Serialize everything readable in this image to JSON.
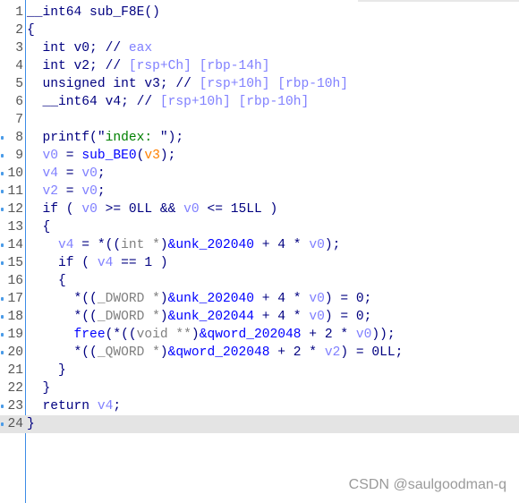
{
  "colors": {
    "default": "#000080",
    "variable": "#8080ff",
    "type": "#808080",
    "function": "#0000ff",
    "string": "#008000",
    "argument": "#ff8000",
    "gutter_border": "#3c8ce6",
    "current_line": "#e4e4e4"
  },
  "current_line": 24,
  "lines": [
    {
      "n": "1",
      "dot": false,
      "tokens": [
        [
          "__int64 sub_F8E()",
          "n"
        ]
      ]
    },
    {
      "n": "2",
      "dot": false,
      "tokens": [
        [
          "{",
          "n"
        ]
      ]
    },
    {
      "n": "3",
      "dot": false,
      "tokens": [
        [
          "  int v0; // ",
          "n"
        ],
        [
          "eax",
          "c"
        ]
      ]
    },
    {
      "n": "4",
      "dot": false,
      "tokens": [
        [
          "  int v2; // ",
          "n"
        ],
        [
          "[rsp+Ch] [rbp-14h]",
          "c"
        ]
      ]
    },
    {
      "n": "5",
      "dot": false,
      "tokens": [
        [
          "  unsigned int v3; // ",
          "n"
        ],
        [
          "[rsp+10h] [rbp-10h]",
          "c"
        ]
      ]
    },
    {
      "n": "6",
      "dot": false,
      "tokens": [
        [
          "  __int64 v4; // ",
          "n"
        ],
        [
          "[rsp+10h] [rbp-10h]",
          "c"
        ]
      ]
    },
    {
      "n": "7",
      "dot": false,
      "tokens": []
    },
    {
      "n": "8",
      "dot": true,
      "tokens": [
        [
          "  printf(\"",
          "n"
        ],
        [
          "index: ",
          "s"
        ],
        [
          "\");",
          "n"
        ]
      ]
    },
    {
      "n": "9",
      "dot": true,
      "tokens": [
        [
          "  ",
          "n"
        ],
        [
          "v0",
          "v"
        ],
        [
          " = ",
          "n"
        ],
        [
          "sub_BE0",
          "f"
        ],
        [
          "(",
          "n"
        ],
        [
          "v3",
          "a"
        ],
        [
          ");",
          "n"
        ]
      ]
    },
    {
      "n": "10",
      "dot": true,
      "tokens": [
        [
          "  ",
          "n"
        ],
        [
          "v4",
          "v"
        ],
        [
          " = ",
          "n"
        ],
        [
          "v0",
          "v"
        ],
        [
          ";",
          "n"
        ]
      ]
    },
    {
      "n": "11",
      "dot": true,
      "tokens": [
        [
          "  ",
          "n"
        ],
        [
          "v2",
          "v"
        ],
        [
          " = ",
          "n"
        ],
        [
          "v0",
          "v"
        ],
        [
          ";",
          "n"
        ]
      ]
    },
    {
      "n": "12",
      "dot": true,
      "tokens": [
        [
          "  if ( ",
          "n"
        ],
        [
          "v0",
          "v"
        ],
        [
          " >= 0LL && ",
          "n"
        ],
        [
          "v0",
          "v"
        ],
        [
          " <= 15LL )",
          "n"
        ]
      ]
    },
    {
      "n": "13",
      "dot": false,
      "tokens": [
        [
          "  {",
          "n"
        ]
      ]
    },
    {
      "n": "14",
      "dot": true,
      "tokens": [
        [
          "    ",
          "n"
        ],
        [
          "v4",
          "v"
        ],
        [
          " = *((",
          "n"
        ],
        [
          "int *",
          "t"
        ],
        [
          ")",
          "n"
        ],
        [
          "&unk_202040",
          "f"
        ],
        [
          " + 4 * ",
          "n"
        ],
        [
          "v0",
          "v"
        ],
        [
          ");",
          "n"
        ]
      ]
    },
    {
      "n": "15",
      "dot": true,
      "tokens": [
        [
          "    if ( ",
          "n"
        ],
        [
          "v4",
          "v"
        ],
        [
          " == 1 )",
          "n"
        ]
      ]
    },
    {
      "n": "16",
      "dot": false,
      "tokens": [
        [
          "    {",
          "n"
        ]
      ]
    },
    {
      "n": "17",
      "dot": true,
      "tokens": [
        [
          "      *((",
          "n"
        ],
        [
          "_DWORD *",
          "t"
        ],
        [
          ")",
          "n"
        ],
        [
          "&unk_202040",
          "f"
        ],
        [
          " + 4 * ",
          "n"
        ],
        [
          "v0",
          "v"
        ],
        [
          ") = 0;",
          "n"
        ]
      ]
    },
    {
      "n": "18",
      "dot": true,
      "tokens": [
        [
          "      *((",
          "n"
        ],
        [
          "_DWORD *",
          "t"
        ],
        [
          ")",
          "n"
        ],
        [
          "&unk_202044",
          "f"
        ],
        [
          " + 4 * ",
          "n"
        ],
        [
          "v0",
          "v"
        ],
        [
          ") = 0;",
          "n"
        ]
      ]
    },
    {
      "n": "19",
      "dot": true,
      "tokens": [
        [
          "      ",
          "n"
        ],
        [
          "free",
          "f"
        ],
        [
          "(*((",
          "n"
        ],
        [
          "void **",
          "t"
        ],
        [
          ")",
          "n"
        ],
        [
          "&qword_202048",
          "f"
        ],
        [
          " + 2 * ",
          "n"
        ],
        [
          "v0",
          "v"
        ],
        [
          "));",
          "n"
        ]
      ]
    },
    {
      "n": "20",
      "dot": true,
      "tokens": [
        [
          "      *((",
          "n"
        ],
        [
          "_QWORD *",
          "t"
        ],
        [
          ")",
          "n"
        ],
        [
          "&qword_202048",
          "f"
        ],
        [
          " + 2 * ",
          "n"
        ],
        [
          "v2",
          "v"
        ],
        [
          ") = 0LL;",
          "n"
        ]
      ]
    },
    {
      "n": "21",
      "dot": false,
      "tokens": [
        [
          "    }",
          "n"
        ]
      ]
    },
    {
      "n": "22",
      "dot": false,
      "tokens": [
        [
          "  }",
          "n"
        ]
      ]
    },
    {
      "n": "23",
      "dot": true,
      "tokens": [
        [
          "  return ",
          "n"
        ],
        [
          "v4",
          "v"
        ],
        [
          ";",
          "n"
        ]
      ]
    },
    {
      "n": "24",
      "dot": true,
      "tokens": [
        [
          "}",
          "n"
        ]
      ]
    }
  ],
  "watermark": "CSDN @saulgoodman-q"
}
